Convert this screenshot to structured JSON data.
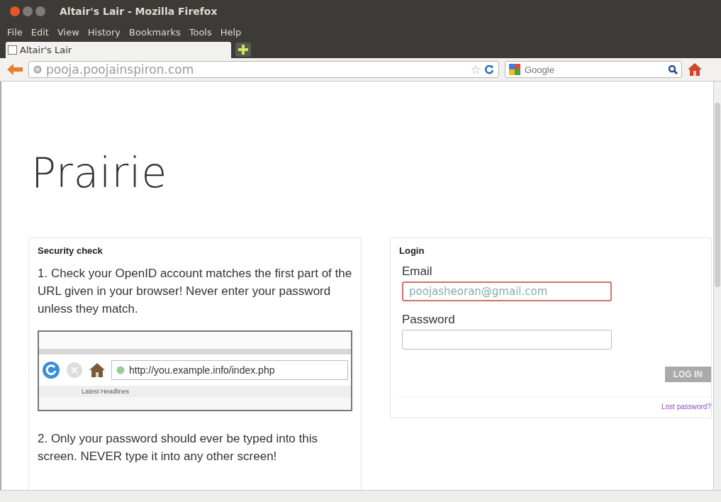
{
  "window": {
    "title": "Altair's Lair - Mozilla Firefox"
  },
  "menu": [
    "File",
    "Edit",
    "View",
    "History",
    "Bookmarks",
    "Tools",
    "Help"
  ],
  "tabs": [
    {
      "label": "Altair's Lair",
      "selected": true
    }
  ],
  "address_bar": {
    "value": "pooja.poojainspiron.com"
  },
  "search": {
    "placeholder": "Google"
  },
  "page": {
    "heading": "Prairie",
    "security": {
      "title": "Security check",
      "step1": "1. Check your OpenID account matches the first part of the URL given in your browser! Never enter your password unless they match.",
      "example": {
        "url": "http://you.example.info/index.php",
        "bookmark": "Latest Headlines"
      },
      "step2": "2. Only your password should ever be typed into this screen. NEVER type it into any other screen!"
    },
    "login": {
      "title": "Login",
      "fields": [
        {
          "label": "Email",
          "value": "poojasheoran@gmail.com",
          "focused": true
        },
        {
          "label": "Password",
          "focused": false
        }
      ],
      "button": "LOG IN",
      "link": "Lost password?"
    }
  }
}
